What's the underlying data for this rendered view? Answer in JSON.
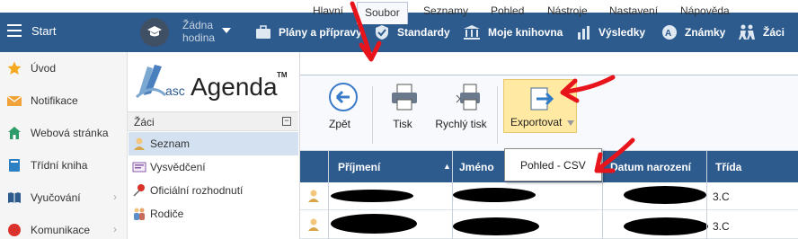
{
  "topbar": {
    "start_label": "Start",
    "hodina_line1": "Žádna",
    "hodina_line2": "hodina",
    "nav": [
      {
        "label": "Plány a přípravy",
        "icon": "briefcase-icon"
      },
      {
        "label": "Standardy",
        "icon": "shield-icon"
      },
      {
        "label": "Moje knihovna",
        "icon": "library-icon"
      },
      {
        "label": "Výsledky",
        "icon": "bar-chart-icon"
      },
      {
        "label": "Známky",
        "icon": "grade-icon"
      },
      {
        "label": "Žáci",
        "icon": "students-icon"
      }
    ]
  },
  "sidebar": {
    "items": [
      {
        "label": "Úvod",
        "icon": "star-icon"
      },
      {
        "label": "Notifikace",
        "icon": "envelope-icon"
      },
      {
        "label": "Webová stránka",
        "icon": "house-icon"
      },
      {
        "label": "Třídní kniha",
        "icon": "book-icon"
      },
      {
        "label": "Vyučování",
        "icon": "open-book-icon"
      },
      {
        "label": "Komunikace",
        "icon": "chat-icon"
      }
    ]
  },
  "logo": {
    "prefix": "asc",
    "name": "Agenda",
    "tm": "TM"
  },
  "zaci_panel": {
    "title": "Žáci",
    "collapse": "−",
    "items": [
      {
        "label": "Seznam",
        "icon": "student-icon"
      },
      {
        "label": "Vysvědčení",
        "icon": "certificate-icon"
      },
      {
        "label": "Oficiální rozhodnutí",
        "icon": "pin-icon"
      },
      {
        "label": "Rodiče",
        "icon": "parents-icon"
      }
    ]
  },
  "ribbon": {
    "tabs": [
      "Hlavní",
      "Soubor",
      "Seznamy",
      "Pohled",
      "Nástroje",
      "Nastavení",
      "Nápověda"
    ],
    "active_tab": "Soubor",
    "buttons": {
      "back": "Zpět",
      "print": "Tisk",
      "quick_print": "Rychlý tisk",
      "export": "Exportovat"
    },
    "export_menu": [
      "Pohled - CSV"
    ]
  },
  "table": {
    "columns": [
      "Příjmení",
      "Jméno",
      "Datum narození",
      "Třída"
    ],
    "sort_indicator": "▲",
    "rows": [
      {
        "trida": "3.C"
      },
      {
        "trida": "3.C"
      }
    ]
  },
  "colors": {
    "topbar": "#2d5b8e",
    "annotation": "#e8141c",
    "export_highlight": "#ffe9a3",
    "selected_row": "#d3e1f1"
  }
}
